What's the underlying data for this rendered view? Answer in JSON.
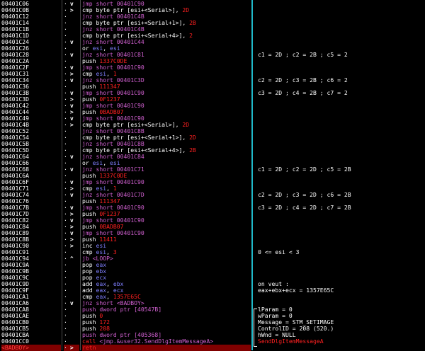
{
  "rows": [
    {
      "addr": "00401C06",
      "mark": "v",
      "ins": [
        {
          "t": "jmp short 00401C90",
          "c": "m"
        }
      ]
    },
    {
      "addr": "00401C0B",
      "mark": ">",
      "ins": [
        {
          "t": "cmp byte ptr [esi+<Serial>], ",
          "c": "w"
        },
        {
          "t": "2D",
          "c": "r"
        }
      ]
    },
    {
      "addr": "00401C12",
      "mark": "·",
      "ins": [
        {
          "t": "jnz short 00401C4B",
          "c": "m"
        }
      ]
    },
    {
      "addr": "00401C14",
      "mark": "·",
      "ins": [
        {
          "t": "cmp byte ptr [esi+<Serial+1>], ",
          "c": "w"
        },
        {
          "t": "2B",
          "c": "r"
        }
      ]
    },
    {
      "addr": "00401C1B",
      "mark": "·",
      "ins": [
        {
          "t": "jnz short 00401C4B",
          "c": "m"
        }
      ]
    },
    {
      "addr": "00401C1D",
      "mark": "·",
      "ins": [
        {
          "t": "cmp byte ptr [esi+<Serial+4>], ",
          "c": "w"
        },
        {
          "t": "2",
          "c": "r"
        }
      ]
    },
    {
      "addr": "00401C24",
      "mark": "v",
      "ins": [
        {
          "t": "jnz short 00401C44",
          "c": "m"
        }
      ]
    },
    {
      "addr": "00401C26",
      "mark": "·",
      "ins": [
        {
          "t": "or ",
          "c": "w"
        },
        {
          "t": "esi",
          "c": "k"
        },
        {
          "t": ", ",
          "c": "w"
        },
        {
          "t": "esi",
          "c": "k"
        }
      ]
    },
    {
      "addr": "00401C28",
      "mark": "v",
      "ins": [
        {
          "t": "jnz short 00401C81",
          "c": "m"
        }
      ]
    },
    {
      "addr": "00401C2A",
      "mark": "·",
      "ins": [
        {
          "t": "push ",
          "c": "w"
        },
        {
          "t": "1337C0DE",
          "c": "r"
        }
      ]
    },
    {
      "addr": "00401C2F",
      "mark": "v",
      "ins": [
        {
          "t": "jmp short 00401C90",
          "c": "m"
        }
      ]
    },
    {
      "addr": "00401C31",
      "mark": ">",
      "ins": [
        {
          "t": "cmp ",
          "c": "w"
        },
        {
          "t": "esi",
          "c": "k"
        },
        {
          "t": ", ",
          "c": "w"
        },
        {
          "t": "1",
          "c": "r"
        }
      ]
    },
    {
      "addr": "00401C34",
      "mark": "v",
      "ins": [
        {
          "t": "jnz short 00401C3D",
          "c": "m"
        }
      ]
    },
    {
      "addr": "00401C36",
      "mark": "·",
      "ins": [
        {
          "t": "push ",
          "c": "w"
        },
        {
          "t": "111347",
          "c": "r"
        }
      ]
    },
    {
      "addr": "00401C3B",
      "mark": "v",
      "ins": [
        {
          "t": "jmp short 00401C90",
          "c": "m"
        }
      ]
    },
    {
      "addr": "00401C3D",
      "mark": ">",
      "ins": [
        {
          "t": "push ",
          "c": "w"
        },
        {
          "t": "0F1237",
          "c": "r"
        }
      ]
    },
    {
      "addr": "00401C42",
      "mark": "v",
      "ins": [
        {
          "t": "jmp short 00401C90",
          "c": "m"
        }
      ]
    },
    {
      "addr": "00401C44",
      "mark": ">",
      "ins": [
        {
          "t": "push ",
          "c": "w"
        },
        {
          "t": "0BADB07",
          "c": "r"
        }
      ]
    },
    {
      "addr": "00401C49",
      "mark": "v",
      "ins": [
        {
          "t": "jmp short 00401C90",
          "c": "m"
        }
      ]
    },
    {
      "addr": "00401C4B",
      "mark": ">",
      "ins": [
        {
          "t": "cmp byte ptr [esi+<Serial>], ",
          "c": "w"
        },
        {
          "t": "2D",
          "c": "r"
        }
      ]
    },
    {
      "addr": "00401C52",
      "mark": "·",
      "ins": [
        {
          "t": "jnz short 00401C8B",
          "c": "m"
        }
      ]
    },
    {
      "addr": "00401C54",
      "mark": "·",
      "ins": [
        {
          "t": "cmp byte ptr [esi+<Serial+1>], ",
          "c": "w"
        },
        {
          "t": "2D",
          "c": "r"
        }
      ]
    },
    {
      "addr": "00401C5B",
      "mark": "·",
      "ins": [
        {
          "t": "jnz short 00401C8B",
          "c": "m"
        }
      ]
    },
    {
      "addr": "00401C5D",
      "mark": "·",
      "ins": [
        {
          "t": "cmp byte ptr [esi+<Serial+4>], ",
          "c": "w"
        },
        {
          "t": "2B",
          "c": "r"
        }
      ]
    },
    {
      "addr": "00401C64",
      "mark": "v",
      "ins": [
        {
          "t": "jnz short 00401C84",
          "c": "m"
        }
      ]
    },
    {
      "addr": "00401C66",
      "mark": "·",
      "ins": [
        {
          "t": "or ",
          "c": "w"
        },
        {
          "t": "esi",
          "c": "k"
        },
        {
          "t": ", ",
          "c": "w"
        },
        {
          "t": "esi",
          "c": "k"
        }
      ]
    },
    {
      "addr": "00401C68",
      "mark": "v",
      "ins": [
        {
          "t": "jnz short 00401C71",
          "c": "m"
        }
      ]
    },
    {
      "addr": "00401C6A",
      "mark": "·",
      "ins": [
        {
          "t": "push ",
          "c": "w"
        },
        {
          "t": "1337C0DE",
          "c": "r"
        }
      ]
    },
    {
      "addr": "00401C6F",
      "mark": "v",
      "ins": [
        {
          "t": "jmp short 00401C90",
          "c": "m"
        }
      ]
    },
    {
      "addr": "00401C71",
      "mark": ">",
      "ins": [
        {
          "t": "cmp ",
          "c": "w"
        },
        {
          "t": "esi",
          "c": "k"
        },
        {
          "t": ", ",
          "c": "w"
        },
        {
          "t": "1",
          "c": "r"
        }
      ]
    },
    {
      "addr": "00401C74",
      "mark": "v",
      "ins": [
        {
          "t": "jnz short 00401C7D",
          "c": "m"
        }
      ]
    },
    {
      "addr": "00401C76",
      "mark": "·",
      "ins": [
        {
          "t": "push ",
          "c": "w"
        },
        {
          "t": "111347",
          "c": "r"
        }
      ]
    },
    {
      "addr": "00401C7B",
      "mark": "v",
      "ins": [
        {
          "t": "jmp short 00401C90",
          "c": "m"
        }
      ]
    },
    {
      "addr": "00401C7D",
      "mark": ">",
      "ins": [
        {
          "t": "push ",
          "c": "w"
        },
        {
          "t": "0F1237",
          "c": "r"
        }
      ]
    },
    {
      "addr": "00401C82",
      "mark": "v",
      "ins": [
        {
          "t": "jmp short 00401C90",
          "c": "m"
        }
      ]
    },
    {
      "addr": "00401C84",
      "mark": ">",
      "ins": [
        {
          "t": "push ",
          "c": "w"
        },
        {
          "t": "0BADB07",
          "c": "r"
        }
      ]
    },
    {
      "addr": "00401C89",
      "mark": "v",
      "ins": [
        {
          "t": "jmp short 00401C90",
          "c": "m"
        }
      ]
    },
    {
      "addr": "00401C8B",
      "mark": ">",
      "ins": [
        {
          "t": "push ",
          "c": "w"
        },
        {
          "t": "11411",
          "c": "r"
        }
      ]
    },
    {
      "addr": "00401C90",
      "mark": ">",
      "ins": [
        {
          "t": "inc ",
          "c": "w"
        },
        {
          "t": "esi",
          "c": "k"
        }
      ]
    },
    {
      "addr": "00401C91",
      "mark": "·",
      "ins": [
        {
          "t": "cmp ",
          "c": "w"
        },
        {
          "t": "esi",
          "c": "k"
        },
        {
          "t": ", ",
          "c": "w"
        },
        {
          "t": "3",
          "c": "r"
        }
      ]
    },
    {
      "addr": "00401C94",
      "mark": "^",
      "ins": [
        {
          "t": "jb <LOOP>",
          "c": "m"
        }
      ]
    },
    {
      "addr": "00401C9A",
      "mark": "·",
      "ins": [
        {
          "t": "pop ",
          "c": "w"
        },
        {
          "t": "eax",
          "c": "k"
        }
      ]
    },
    {
      "addr": "00401C9B",
      "mark": "·",
      "ins": [
        {
          "t": "pop ",
          "c": "w"
        },
        {
          "t": "ebx",
          "c": "k"
        }
      ]
    },
    {
      "addr": "00401C9C",
      "mark": "·",
      "ins": [
        {
          "t": "pop ",
          "c": "w"
        },
        {
          "t": "ecx",
          "c": "k"
        }
      ]
    },
    {
      "addr": "00401C9D",
      "mark": "·",
      "ins": [
        {
          "t": "add ",
          "c": "w"
        },
        {
          "t": "eax",
          "c": "k"
        },
        {
          "t": ", ",
          "c": "w"
        },
        {
          "t": "ebx",
          "c": "k"
        }
      ]
    },
    {
      "addr": "00401C9F",
      "mark": "·",
      "ins": [
        {
          "t": "add ",
          "c": "w"
        },
        {
          "t": "eax",
          "c": "k"
        },
        {
          "t": ", ",
          "c": "w"
        },
        {
          "t": "ecx",
          "c": "k"
        }
      ]
    },
    {
      "addr": "00401CA1",
      "mark": "·",
      "ins": [
        {
          "t": "cmp ",
          "c": "w"
        },
        {
          "t": "eax",
          "c": "k"
        },
        {
          "t": ", ",
          "c": "w"
        },
        {
          "t": "1357E65C",
          "c": "r"
        }
      ]
    },
    {
      "addr": "00401CA6",
      "mark": "v",
      "ins": [
        {
          "t": "jnz short <BADBOY>",
          "c": "m"
        }
      ]
    },
    {
      "addr": "00401CA8",
      "mark": "·",
      "ins": [
        {
          "t": "push dword ptr [40547B]",
          "c": "m"
        }
      ]
    },
    {
      "addr": "00401CAE",
      "mark": "·",
      "ins": [
        {
          "t": "push ",
          "c": "w"
        },
        {
          "t": "0",
          "c": "r"
        }
      ]
    },
    {
      "addr": "00401CB0",
      "mark": "·",
      "ins": [
        {
          "t": "push ",
          "c": "w"
        },
        {
          "t": "172",
          "c": "r"
        }
      ]
    },
    {
      "addr": "00401CB5",
      "mark": "·",
      "ins": [
        {
          "t": "push ",
          "c": "w"
        },
        {
          "t": "208",
          "c": "r"
        }
      ]
    },
    {
      "addr": "00401CBA",
      "mark": "·",
      "ins": [
        {
          "t": "push dword ptr [405368]",
          "c": "m"
        }
      ]
    },
    {
      "addr": "00401CC0",
      "mark": "·",
      "ins": [
        {
          "t": "call ",
          "c": "r"
        },
        {
          "t": "<jmp.&user32.SendDlgItemMessageA>",
          "c": "m"
        }
      ]
    },
    {
      "addr": "<BADBOY>",
      "mark": ">",
      "sel": true,
      "ins": [
        {
          "t": "retn",
          "c": "r"
        }
      ]
    }
  ],
  "comments": [
    {
      "row": 8,
      "text": "c1 = 2D ; c2 = 2B ; c5 = 2"
    },
    {
      "row": 12,
      "text": "c2 = 2D ; c3 = 2B ; c6 = 2"
    },
    {
      "row": 14,
      "text": "c3 = 2D ; c4 = 2B ; c7 = 2"
    },
    {
      "row": 26,
      "text": "c1 = 2D ; c2 = 2D ; c5 = 2B"
    },
    {
      "row": 30,
      "text": "c2 = 2D ; c3 = 2D ; c6 = 2B"
    },
    {
      "row": 32,
      "text": "c3 = 2D ; c4 = 2D ; c7 = 2B"
    },
    {
      "row": 39,
      "text": "0 <= esi < 3"
    },
    {
      "row": 44,
      "text": "on veut :"
    },
    {
      "row": 45,
      "text": "eax+ebx+ecx = 1357E65C"
    }
  ],
  "params": [
    {
      "row": 48,
      "text": "lParam = 0"
    },
    {
      "row": 49,
      "text": "wParam = 0"
    },
    {
      "row": 50,
      "text": "Message = STM_SETIMAGE"
    },
    {
      "row": 51,
      "text": "ControlID = 208 (520.)"
    },
    {
      "row": 52,
      "text": "hWnd = NULL"
    }
  ],
  "call_name": "SendDlgItemMessageA",
  "colors": {
    "white": "#ffffff",
    "red": "#ff2020",
    "magenta": "#d060d0",
    "blue": "#7f7fff",
    "selection": "#800000",
    "separator": "#20b8c8"
  }
}
